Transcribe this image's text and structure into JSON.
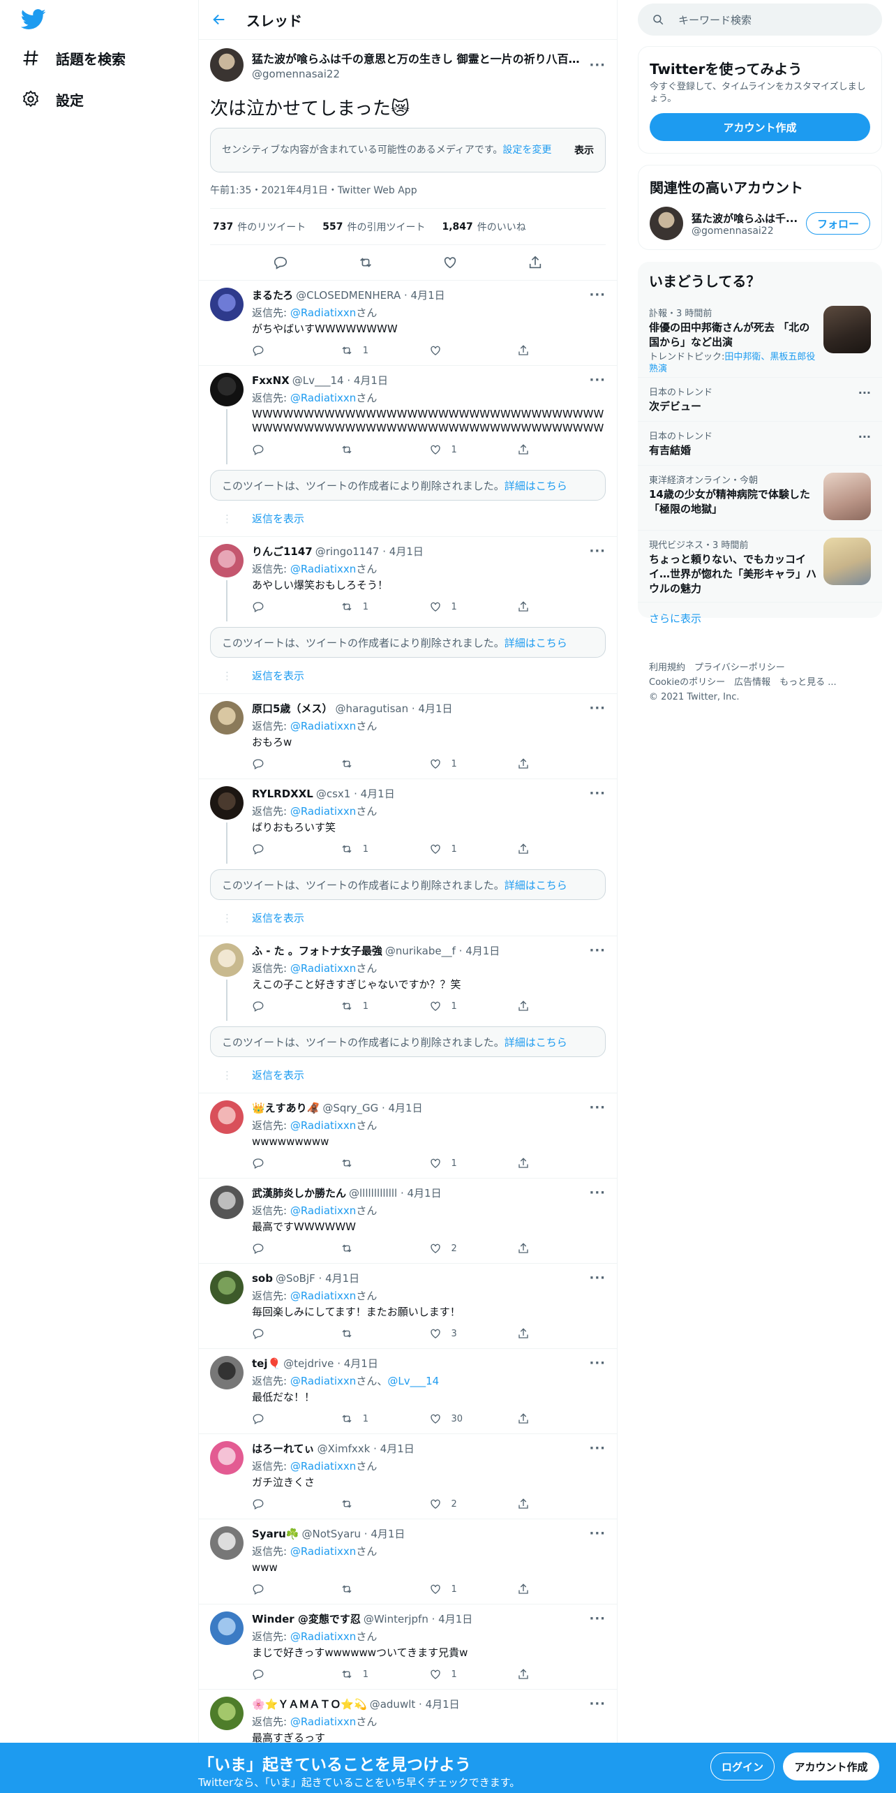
{
  "nav": {
    "explore": "話題を検索",
    "settings": "設定"
  },
  "header": {
    "title": "スレッド"
  },
  "main": {
    "author_name": "猛た波が喰らふは千の意思と万の生きし 御霊と一片の祈り八百万掬",
    "author_handle": "@gomennasai22",
    "text": "次は泣かせてしまった😿",
    "sensitive_text": "センシティブな内容が含まれている可能性のあるメディアです。",
    "sensitive_link": "設定を変更",
    "show_label": "表示",
    "timestamp": "午前1:35・2021年4月1日・Twitter Web App",
    "retweets": "737",
    "retweets_label": "件のリツイート",
    "quotes": "557",
    "quotes_label": "件の引用ツイート",
    "likes": "1,847",
    "likes_label": "件のいいね"
  },
  "reply_prefix": "返信先:",
  "reply_suffix": "さん",
  "deleted_text": "このツイートは、ツイートの作成者により削除されました。",
  "deleted_link": "詳細はこちら",
  "show_replies": "返信を表示",
  "replies": [
    {
      "name": "まるたろ",
      "handle": "@CLOSEDMENHERA",
      "date": "4月1日",
      "to": "@Radiatixxn",
      "text": "がちやばいすWWWWWWWW",
      "rt": "1",
      "like": "",
      "thread": false
    },
    {
      "name": "FxxNX",
      "handle": "@Lv___14",
      "date": "4月1日",
      "to": "@Radiatixxn",
      "text": "WWWWWWWWWWWWWWWWWWWWWWWWWWWWWWWWWWWWWWWWWWWWWWWWWWWWWWWWWWWWWWWWWWWW",
      "rt": "",
      "like": "1",
      "thread": true
    },
    {
      "name": "りんご1147",
      "handle": "@ringo1147",
      "date": "4月1日",
      "to": "@Radiatixxn",
      "text": "あやしい爆笑おもしろそう！",
      "rt": "1",
      "like": "1",
      "thread": true
    },
    {
      "name": "原口5歳（メス）",
      "handle": "@haragutisan",
      "date": "4月1日",
      "to": "@Radiatixxn",
      "text": "おもろw",
      "rt": "",
      "like": "1",
      "thread": false
    },
    {
      "name": "RYLRDXXL",
      "handle": "@csx1",
      "date": "4月1日",
      "to": "@Radiatixxn",
      "text": "ばりおもろいす笑",
      "rt": "1",
      "like": "1",
      "thread": true
    },
    {
      "name": "ふ - た 。フォトナ女子最強",
      "handle": "@nurikabe__f",
      "date": "4月1日",
      "to": "@Radiatixxn",
      "text": "えこの子こと好きすぎじゃないですか？？笑",
      "rt": "1",
      "like": "1",
      "thread": true
    },
    {
      "name": "👑えすあり🦧",
      "handle": "@Sqry_GG",
      "date": "4月1日",
      "to": "@Radiatixxn",
      "text": "wwwwwwwww",
      "rt": "",
      "like": "1",
      "thread": false
    },
    {
      "name": "武漢肺炎しか勝たん",
      "handle": "@lllllllllllll",
      "date": "4月1日",
      "to": "@Radiatixxn",
      "text": "最高ですWWWWWW",
      "rt": "",
      "like": "2",
      "thread": false
    },
    {
      "name": "sob",
      "handle": "@SoBjF",
      "date": "4月1日",
      "to": "@Radiatixxn",
      "text": "毎回楽しみにしてます！またお願いします！",
      "rt": "",
      "like": "3",
      "thread": false
    },
    {
      "name": "tej🎈",
      "handle": "@tejdrive",
      "date": "4月1日",
      "to": "@Radiatixxn",
      "to2": "@Lv___14",
      "text": "最低だな！！",
      "rt": "1",
      "like": "30",
      "thread": false
    },
    {
      "name": "はろーれてぃ",
      "handle": "@Ximfxxk",
      "date": "4月1日",
      "to": "@Radiatixxn",
      "text": "ガチ泣きくさ",
      "rt": "",
      "like": "2",
      "thread": false
    },
    {
      "name": "Syaru☘️",
      "handle": "@NotSyaru",
      "date": "4月1日",
      "to": "@Radiatixxn",
      "text": "www",
      "rt": "",
      "like": "1",
      "thread": false
    },
    {
      "name": "Winder @変態です忍",
      "handle": "@Winterjpfn",
      "date": "4月1日",
      "to": "@Radiatixxn",
      "text": "まじで好きっすwwwwwwついてきます兄貴w",
      "rt": "1",
      "like": "1",
      "thread": false
    },
    {
      "name": "🌸⭐ＹＡＭＡＴＯ⭐💫",
      "handle": "@aduwlt",
      "date": "4月1日",
      "to": "@Radiatixxn",
      "text": "最高すぎるっす",
      "rt": "",
      "like": "",
      "thread": false
    }
  ],
  "search": {
    "placeholder": "キーワード検索"
  },
  "signup_card": {
    "title": "Twitterを使ってみよう",
    "subtitle": "今すぐ登録して、タイムラインをカスタマイズしましょう。",
    "button": "アカウント作成"
  },
  "related": {
    "title": "関連性の高いアカウント",
    "name": "猛た波が喰らふは千...",
    "handle": "@gomennasai22",
    "follow": "フォロー"
  },
  "trends": {
    "title": "いまどうしてる？",
    "items": [
      {
        "meta": "訃報・3 時間前",
        "name": "俳優の田中邦衛さんが死去 「北の国から」など出演",
        "topic_prefix": "トレンドトピック:",
        "topic": "田中邦衛、黒板五郎役熟演"
      },
      {
        "meta": "日本のトレンド",
        "name": "次デビュー"
      },
      {
        "meta": "日本のトレンド",
        "name": "有吉結婚"
      },
      {
        "meta": "東洋経済オンライン・今朝",
        "name": "14歳の少女が精神病院で体験した「極限の地獄」"
      },
      {
        "meta": "現代ビジネス・3 時間前",
        "name": "ちょっと頼りない、でもカッコイイ…世界が惚れた「美形キャラ」ハウルの魅力"
      }
    ],
    "more": "さらに表示"
  },
  "footer": {
    "l1": "利用規約　プライバシーポリシー",
    "l2": "Cookieのポリシー　広告情報　もっと見る ...",
    "l3": "© 2021 Twitter, Inc."
  },
  "bottom": {
    "headline": "「いま」起きていることを見つけよう",
    "sub": "Twitterなら、「いま」起きていることをいち早くチェックできます。",
    "login": "ログイン",
    "signup": "アカウント作成"
  },
  "colors": {
    "accent": "#1d9bf0",
    "secondary_text": "#536471"
  }
}
